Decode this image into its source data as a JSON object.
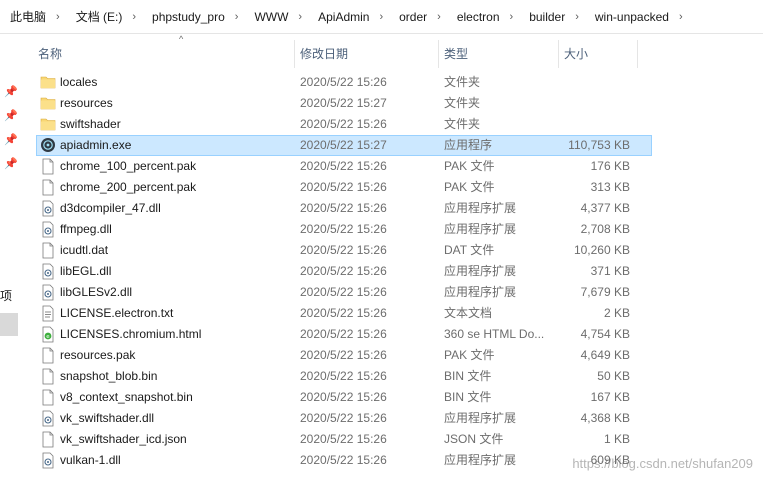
{
  "breadcrumb": [
    "此电脑",
    "文档 (E:)",
    "phpstudy_pro",
    "WWW",
    "ApiAdmin",
    "order",
    "electron",
    "builder",
    "win-unpacked"
  ],
  "nav": {
    "partial_label": "项"
  },
  "columns": {
    "name": "名称",
    "date": "修改日期",
    "type": "类型",
    "size": "大小"
  },
  "files": [
    {
      "name": "locales",
      "date": "2020/5/22 15:26",
      "type": "文件夹",
      "size": "",
      "icon": "folder-icon"
    },
    {
      "name": "resources",
      "date": "2020/5/22 15:27",
      "type": "文件夹",
      "size": "",
      "icon": "folder-icon"
    },
    {
      "name": "swiftshader",
      "date": "2020/5/22 15:26",
      "type": "文件夹",
      "size": "",
      "icon": "folder-icon"
    },
    {
      "name": "apiadmin.exe",
      "date": "2020/5/22 15:27",
      "type": "应用程序",
      "size": "110,753 KB",
      "icon": "app-icon",
      "selected": true
    },
    {
      "name": "chrome_100_percent.pak",
      "date": "2020/5/22 15:26",
      "type": "PAK 文件",
      "size": "176 KB",
      "icon": "file-icon"
    },
    {
      "name": "chrome_200_percent.pak",
      "date": "2020/5/22 15:26",
      "type": "PAK 文件",
      "size": "313 KB",
      "icon": "file-icon"
    },
    {
      "name": "d3dcompiler_47.dll",
      "date": "2020/5/22 15:26",
      "type": "应用程序扩展",
      "size": "4,377 KB",
      "icon": "dll-icon"
    },
    {
      "name": "ffmpeg.dll",
      "date": "2020/5/22 15:26",
      "type": "应用程序扩展",
      "size": "2,708 KB",
      "icon": "dll-icon"
    },
    {
      "name": "icudtl.dat",
      "date": "2020/5/22 15:26",
      "type": "DAT 文件",
      "size": "10,260 KB",
      "icon": "file-icon"
    },
    {
      "name": "libEGL.dll",
      "date": "2020/5/22 15:26",
      "type": "应用程序扩展",
      "size": "371 KB",
      "icon": "dll-icon"
    },
    {
      "name": "libGLESv2.dll",
      "date": "2020/5/22 15:26",
      "type": "应用程序扩展",
      "size": "7,679 KB",
      "icon": "dll-icon"
    },
    {
      "name": "LICENSE.electron.txt",
      "date": "2020/5/22 15:26",
      "type": "文本文档",
      "size": "2 KB",
      "icon": "text-file-icon"
    },
    {
      "name": "LICENSES.chromium.html",
      "date": "2020/5/22 15:26",
      "type": "360 se HTML Do...",
      "size": "4,754 KB",
      "icon": "html-file-icon"
    },
    {
      "name": "resources.pak",
      "date": "2020/5/22 15:26",
      "type": "PAK 文件",
      "size": "4,649 KB",
      "icon": "file-icon"
    },
    {
      "name": "snapshot_blob.bin",
      "date": "2020/5/22 15:26",
      "type": "BIN 文件",
      "size": "50 KB",
      "icon": "file-icon"
    },
    {
      "name": "v8_context_snapshot.bin",
      "date": "2020/5/22 15:26",
      "type": "BIN 文件",
      "size": "167 KB",
      "icon": "file-icon"
    },
    {
      "name": "vk_swiftshader.dll",
      "date": "2020/5/22 15:26",
      "type": "应用程序扩展",
      "size": "4,368 KB",
      "icon": "dll-icon"
    },
    {
      "name": "vk_swiftshader_icd.json",
      "date": "2020/5/22 15:26",
      "type": "JSON 文件",
      "size": "1 KB",
      "icon": "file-icon"
    },
    {
      "name": "vulkan-1.dll",
      "date": "2020/5/22 15:26",
      "type": "应用程序扩展",
      "size": "609 KB",
      "icon": "dll-icon"
    }
  ],
  "watermark": "https://blog.csdn.net/shufan209",
  "colors": {
    "selection_bg": "#cce8ff",
    "selection_border": "#99d1ff",
    "folder": "#f8d775",
    "header_text": "#4c607a"
  }
}
